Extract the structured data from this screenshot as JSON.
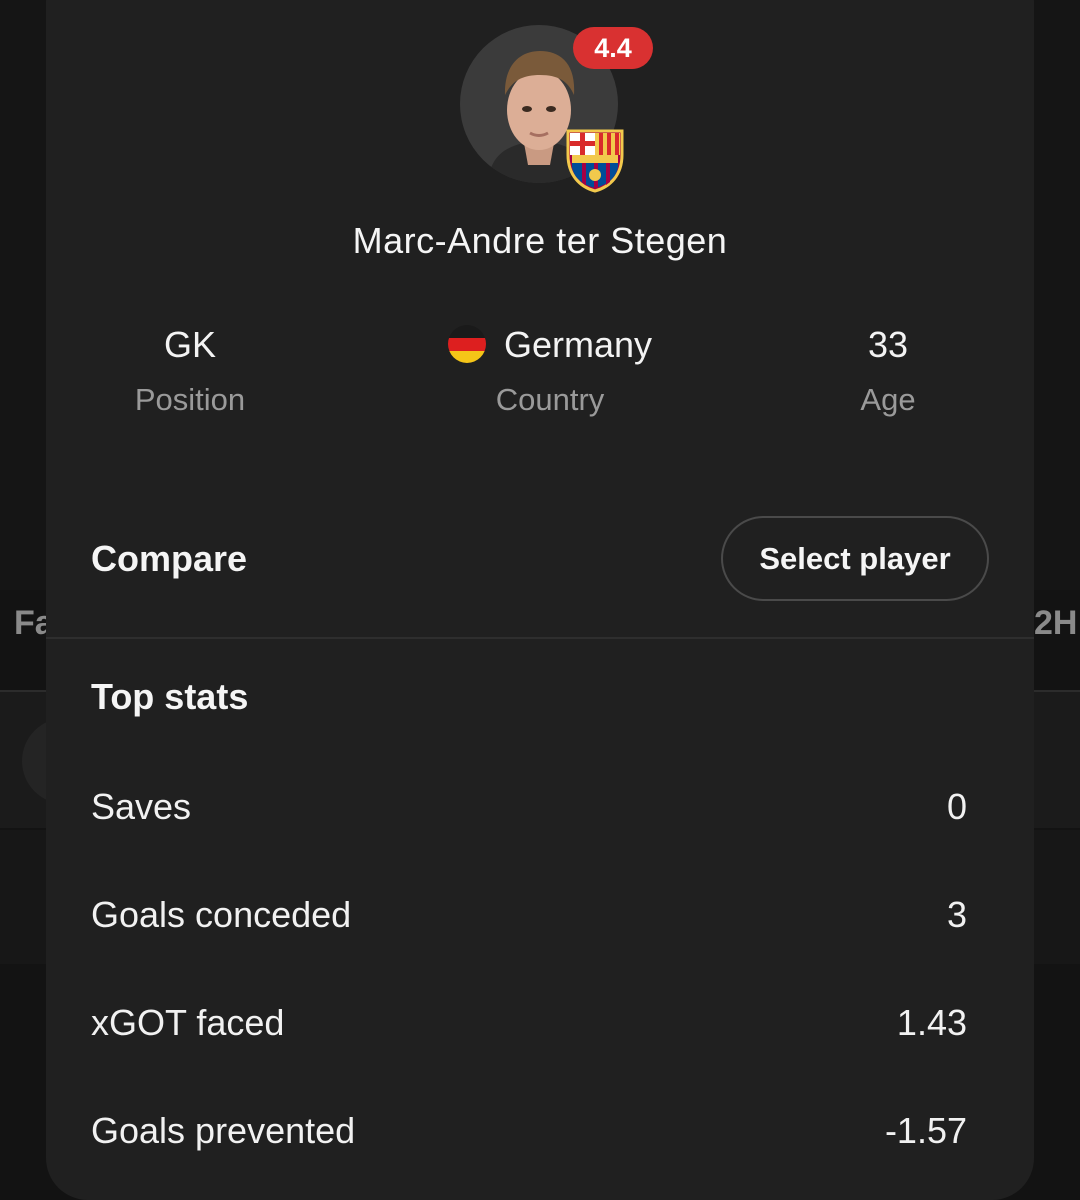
{
  "background": {
    "tab_left_partial": "Fa",
    "tab_right_partial": "2H"
  },
  "player": {
    "name": "Marc-Andre ter Stegen",
    "rating": "4.4",
    "rating_color": "#d93131",
    "club_badge": "fc-barcelona-crest",
    "avatar": "player-photo"
  },
  "info": [
    {
      "value": "GK",
      "label": "Position"
    },
    {
      "value": "Germany",
      "label": "Country",
      "flag": "germany-flag"
    },
    {
      "value": "33",
      "label": "Age"
    }
  ],
  "compare": {
    "label": "Compare",
    "button": "Select player"
  },
  "top_stats": {
    "title": "Top stats",
    "rows": [
      {
        "label": "Saves",
        "value": "0"
      },
      {
        "label": "Goals conceded",
        "value": "3"
      },
      {
        "label": "xGOT faced",
        "value": "1.43"
      },
      {
        "label": "Goals prevented",
        "value": "-1.57"
      }
    ]
  },
  "colors": {
    "sheet_background": "#202020",
    "page_background": "#131313",
    "muted_text": "#9a9a9a"
  }
}
